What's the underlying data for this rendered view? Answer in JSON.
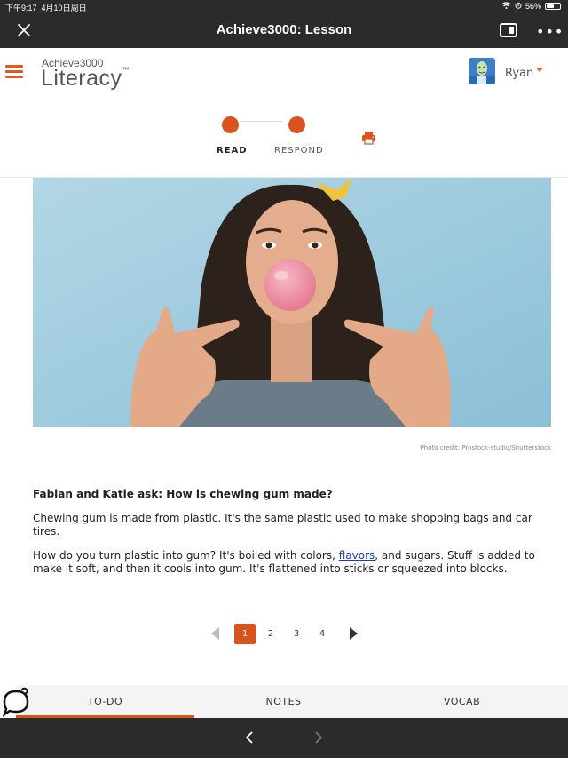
{
  "status_bar": {
    "time": "下午9:17",
    "date": "4月10日周日",
    "battery": "56%",
    "battery_level": 0.56
  },
  "app_bar": {
    "title": "Achieve3000: Lesson",
    "more_label": "•••"
  },
  "brand": {
    "top": "Achieve3000",
    "main": "Literacy",
    "tm": "™"
  },
  "user": {
    "name": "Ryan"
  },
  "steps": [
    {
      "label": "READ"
    },
    {
      "label": "RESPOND"
    }
  ],
  "article": {
    "photo_credit": "Photo credit: Prostock-studio/Shutterstock",
    "heading": "Fabian and Katie ask: How is chewing gum made?",
    "p1": "Chewing gum is made from plastic. It's the same plastic used to make shopping bags and car tires.",
    "p2_before": "How do you turn plastic into gum? It's boiled with colors, ",
    "p2_link": "flavors",
    "p2_after": ", and sugars. Stuff is added to make it soft, and then it cools into gum. It's flattened into sticks or squeezed into blocks."
  },
  "pagination": {
    "pages": [
      "1",
      "2",
      "3",
      "4"
    ],
    "current": "1"
  },
  "tabs": [
    {
      "label": "TO-DO"
    },
    {
      "label": "NOTES"
    },
    {
      "label": "VOCAB"
    }
  ],
  "colors": {
    "accent": "#d9531e",
    "bar": "#2b2b2b",
    "link": "#1a3ecc"
  },
  "icons": [
    "close-icon",
    "split-view-icon",
    "more-icon",
    "menu-icon",
    "print-icon",
    "chat-icon",
    "chevron-left-icon",
    "chevron-right-icon"
  ]
}
